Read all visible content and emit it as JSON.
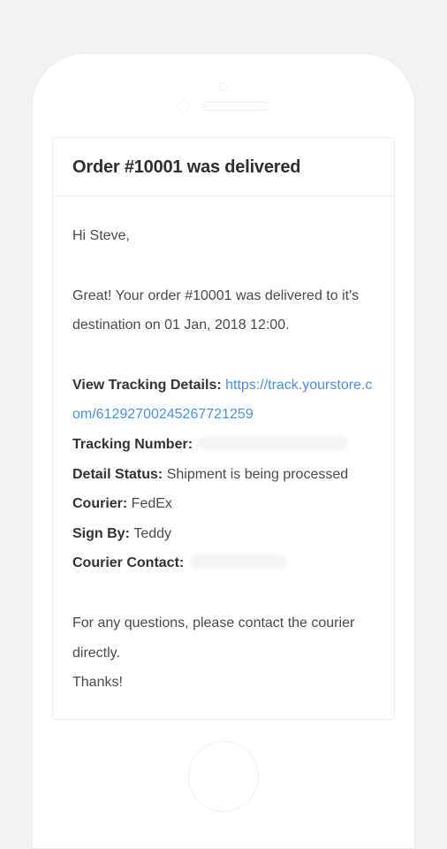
{
  "email": {
    "title": "Order #10001 was delivered",
    "greeting": "Hi Steve,",
    "intro": "Great! Your order  #10001 was delivered to it's destination on 01 Jan, 2018 12:00.",
    "tracking": {
      "view_label": "View Tracking Details:",
      "url": "https://track.yourstore.com/61292700245267721259",
      "number_label": "Tracking Number:",
      "number_value": "",
      "status_label": "Detail Status:",
      "status_value": "Shipment is being processed",
      "courier_label": "Courier:",
      "courier_value": "FedEx",
      "sign_label": "Sign By:",
      "sign_value": "Teddy",
      "contact_label": "Courier Contact:",
      "contact_value": ""
    },
    "footer_line1": "For any questions, please contact the courier directly.",
    "footer_line2": "Thanks!"
  }
}
